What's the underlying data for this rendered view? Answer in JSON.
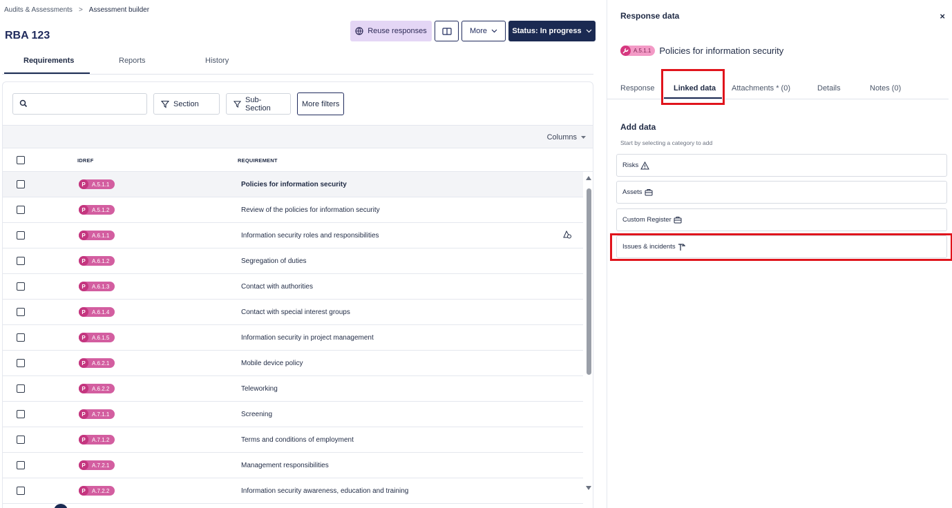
{
  "breadcrumb": {
    "parent": "Audits & Assessments",
    "separator": ">",
    "current": "Assessment builder"
  },
  "page": {
    "title": "RBA 123"
  },
  "toolbar": {
    "reuse_label": "Reuse responses",
    "more_label": "More",
    "status_label": "Status: In progress"
  },
  "tabs": [
    {
      "label": "Requirements",
      "active": true
    },
    {
      "label": "Reports",
      "active": false
    },
    {
      "label": "History",
      "active": false
    }
  ],
  "filters": {
    "search_placeholder": "",
    "section_label": "Section",
    "subsection_label": "Sub-Section",
    "more_filters_label": "More filters"
  },
  "columns_label": "Columns",
  "table": {
    "headers": {
      "idref": "IDREF",
      "requirement": "REQUIREMENT"
    },
    "rows": [
      {
        "p": "P",
        "id": "A.5.1.1",
        "req": "Policies for information security",
        "selected": true,
        "flag": false
      },
      {
        "p": "P",
        "id": "A.5.1.2",
        "req": "Review of the policies for information security",
        "selected": false,
        "flag": false
      },
      {
        "p": "P",
        "id": "A.6.1.1",
        "req": "Information security roles and responsibilities",
        "selected": false,
        "flag": true
      },
      {
        "p": "P",
        "id": "A.6.1.2",
        "req": "Segregation of duties",
        "selected": false,
        "flag": false
      },
      {
        "p": "P",
        "id": "A.6.1.3",
        "req": "Contact with authorities",
        "selected": false,
        "flag": false
      },
      {
        "p": "P",
        "id": "A.6.1.4",
        "req": "Contact with special interest groups",
        "selected": false,
        "flag": false
      },
      {
        "p": "P",
        "id": "A.6.1.5",
        "req": "Information security in project management",
        "selected": false,
        "flag": false
      },
      {
        "p": "P",
        "id": "A.6.2.1",
        "req": "Mobile device policy",
        "selected": false,
        "flag": false
      },
      {
        "p": "P",
        "id": "A.6.2.2",
        "req": "Teleworking",
        "selected": false,
        "flag": false
      },
      {
        "p": "P",
        "id": "A.7.1.1",
        "req": "Screening",
        "selected": false,
        "flag": false
      },
      {
        "p": "P",
        "id": "A.7.1.2",
        "req": "Terms and conditions of employment",
        "selected": false,
        "flag": false
      },
      {
        "p": "P",
        "id": "A.7.2.1",
        "req": "Management responsibilities",
        "selected": false,
        "flag": false
      },
      {
        "p": "P",
        "id": "A.7.2.2",
        "req": "Information security awareness, education and training",
        "selected": false,
        "flag": false
      }
    ]
  },
  "panel": {
    "title": "Response data",
    "close_label": "×",
    "ref_id": "A.5.1.1",
    "ref_title": "Policies for information security",
    "tabs": [
      {
        "label": "Response",
        "active": false
      },
      {
        "label": "Linked data",
        "active": true
      },
      {
        "label": "Attachments * (0)",
        "active": false
      },
      {
        "label": "Details",
        "active": false
      },
      {
        "label": "Notes (0)",
        "active": false
      }
    ],
    "add_title": "Add data",
    "add_subtitle": "Start by selecting a category to add",
    "categories": [
      {
        "label": "Risks",
        "icon": "warning-icon"
      },
      {
        "label": "Assets",
        "icon": "briefcase-icon"
      },
      {
        "label": "Custom Register",
        "icon": "briefcase-icon"
      },
      {
        "label": "Issues & incidents",
        "icon": "hammer-icon"
      }
    ]
  },
  "colors": {
    "navy": "#1b2a52",
    "pill": "#d35ea0",
    "pill_dark": "#c4367f",
    "reuse_bg": "#e4d6f5",
    "highlight": "#e0141c"
  }
}
